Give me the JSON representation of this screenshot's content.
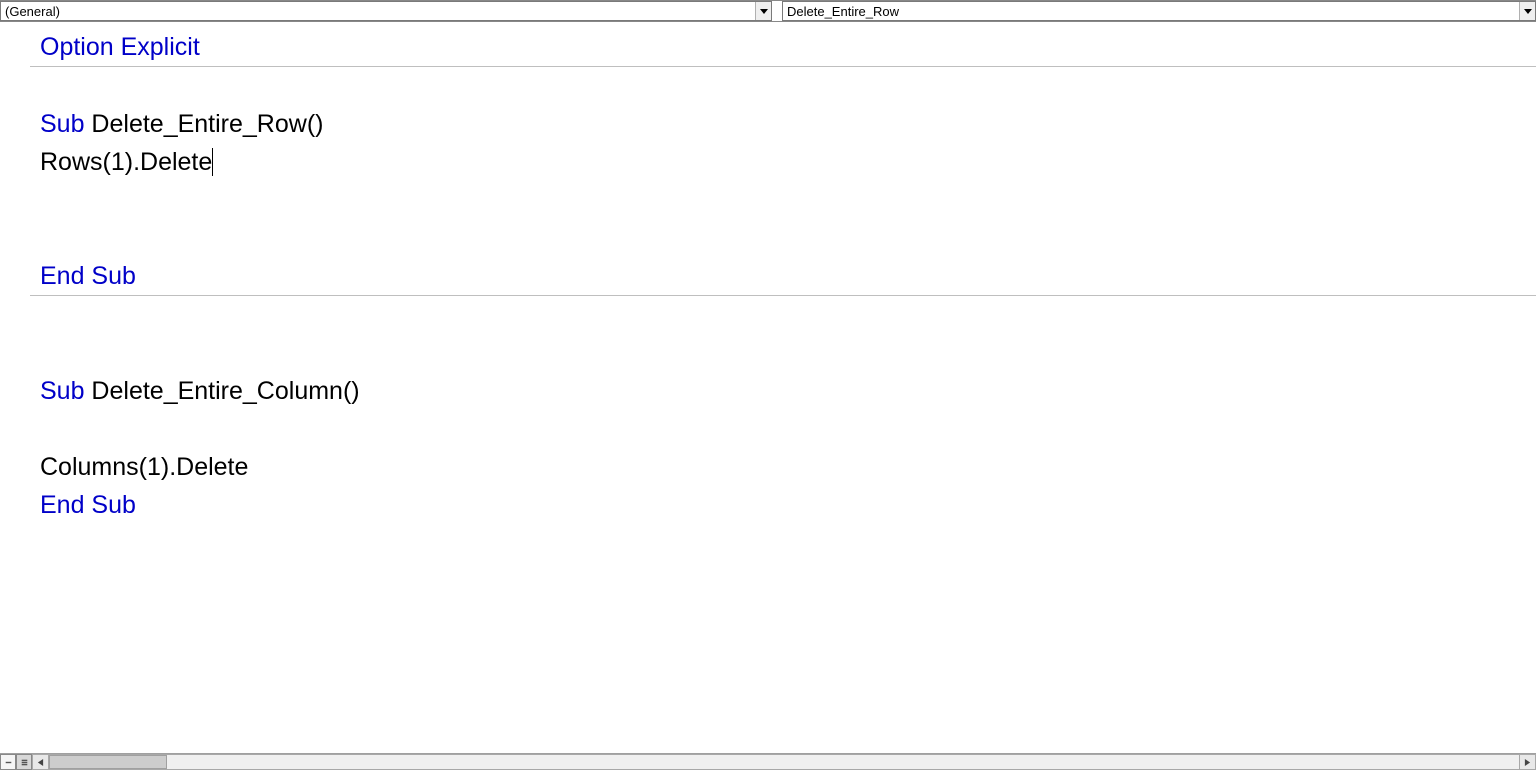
{
  "dropdowns": {
    "object": "(General)",
    "procedure": "Delete_Entire_Row"
  },
  "code": {
    "option_explicit": "Option Explicit",
    "sub1_keyword": "Sub",
    "sub1_name": " Delete_Entire_Row()",
    "sub1_body": "Rows(1).Delete",
    "end_sub1": "End Sub",
    "sub2_keyword": "Sub",
    "sub2_name": " Delete_Entire_Column()",
    "sub2_body": "Columns(1).Delete",
    "end_sub2": "End Sub"
  }
}
